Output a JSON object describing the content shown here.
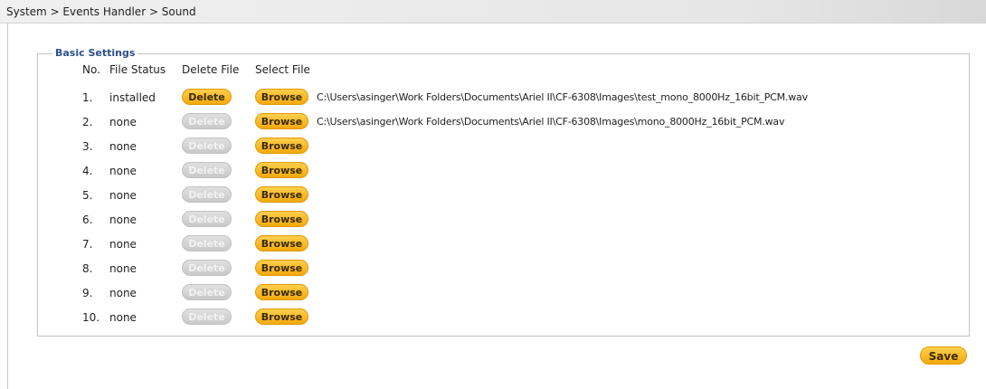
{
  "breadcrumb": "System > Events Handler > Sound",
  "group_title": "Basic Settings",
  "columns": {
    "no": "No.",
    "file_status": "File Status",
    "delete_file": "Delete File",
    "select_file": "Select File"
  },
  "rows": [
    {
      "no": "1.",
      "status": "installed",
      "delete_label": "Delete",
      "delete_enabled": true,
      "browse_label": "Browse",
      "path": "C:\\Users\\asinger\\Work Folders\\Documents\\Ariel II\\CF-6308\\Images\\test_mono_8000Hz_16bit_PCM.wav"
    },
    {
      "no": "2.",
      "status": "none",
      "delete_label": "Delete",
      "delete_enabled": false,
      "browse_label": "Browse",
      "path": "C:\\Users\\asinger\\Work Folders\\Documents\\Ariel II\\CF-6308\\Images\\mono_8000Hz_16bit_PCM.wav"
    },
    {
      "no": "3.",
      "status": "none",
      "delete_label": "Delete",
      "delete_enabled": false,
      "browse_label": "Browse",
      "path": ""
    },
    {
      "no": "4.",
      "status": "none",
      "delete_label": "Delete",
      "delete_enabled": false,
      "browse_label": "Browse",
      "path": ""
    },
    {
      "no": "5.",
      "status": "none",
      "delete_label": "Delete",
      "delete_enabled": false,
      "browse_label": "Browse",
      "path": ""
    },
    {
      "no": "6.",
      "status": "none",
      "delete_label": "Delete",
      "delete_enabled": false,
      "browse_label": "Browse",
      "path": ""
    },
    {
      "no": "7.",
      "status": "none",
      "delete_label": "Delete",
      "delete_enabled": false,
      "browse_label": "Browse",
      "path": ""
    },
    {
      "no": "8.",
      "status": "none",
      "delete_label": "Delete",
      "delete_enabled": false,
      "browse_label": "Browse",
      "path": ""
    },
    {
      "no": "9.",
      "status": "none",
      "delete_label": "Delete",
      "delete_enabled": false,
      "browse_label": "Browse",
      "path": ""
    },
    {
      "no": "10.",
      "status": "none",
      "delete_label": "Delete",
      "delete_enabled": false,
      "browse_label": "Browse",
      "path": ""
    }
  ],
  "save_label": "Save",
  "colors": {
    "accent": "#f3a90d",
    "disabled": "#c9c9c9",
    "title": "#2d4f8c"
  }
}
